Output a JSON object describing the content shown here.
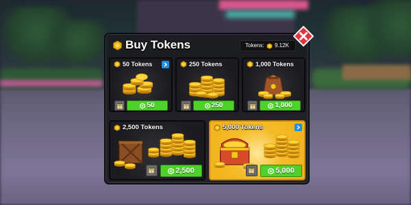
{
  "shop": {
    "title": "Buy Tokens",
    "balance_label": "Tokens:",
    "balance_value": "9.12K",
    "close_icon": "close-x-icon"
  },
  "packages": [
    {
      "name": "50 Tokens",
      "price": "50",
      "icon": "coin-pile-small",
      "has_info": true
    },
    {
      "name": "250 Tokens",
      "price": "250",
      "icon": "coin-stacks",
      "has_info": false
    },
    {
      "name": "1,000 Tokens",
      "price": "1,000",
      "icon": "coin-sack",
      "has_info": false
    },
    {
      "name": "2,500 Tokens",
      "price": "2,500",
      "icon": "coin-crate",
      "has_info": false
    },
    {
      "name": "5,000 Tokens",
      "price": "5,000",
      "icon": "treasure-chest",
      "has_info": true,
      "featured": true
    }
  ],
  "colors": {
    "panel_bg": "#1c1c20",
    "price_green": "#4fd12c",
    "featured_gold": "#f2b51f",
    "coin_gold": "#f5c518",
    "close_red": "#e0333c",
    "info_blue": "#1f8fe0"
  }
}
